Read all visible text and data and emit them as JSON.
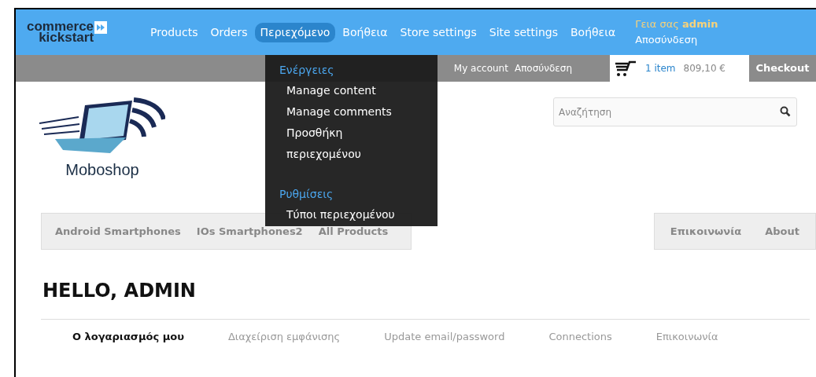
{
  "header": {
    "logo": {
      "line1": "commerce",
      "line2": "kickstart"
    },
    "nav": [
      {
        "label": "Products",
        "selected": false
      },
      {
        "label": "Orders",
        "selected": false
      },
      {
        "label": "Περιεχόμενο",
        "selected": true
      },
      {
        "label": "Βοήθεια",
        "selected": false
      },
      {
        "label": "Store settings",
        "selected": false
      },
      {
        "label": "Site settings",
        "selected": false
      },
      {
        "label": "Βοήθεια",
        "selected": false
      }
    ],
    "greeting": {
      "text": "Γεια σας",
      "user": "admin",
      "logout": "Αποσύνδεση"
    }
  },
  "dropdown": [
    {
      "heading": "Ενέργειες",
      "items": [
        "Manage content",
        "Manage comments",
        "Προσθήκη περιεχομένου"
      ]
    },
    {
      "heading": "Ρυθμίσεις",
      "items": [
        "Τύποι περιεχομένου"
      ]
    }
  ],
  "account_bar": {
    "links": [
      "My account",
      "Αποσύνδεση"
    ],
    "cart": {
      "count": "1 item",
      "total": "809,10 €"
    },
    "checkout": "Checkout"
  },
  "store": {
    "name": "Moboshop",
    "search": {
      "placeholder": "Αναζήτηση"
    }
  },
  "category_nav": [
    "Android Smartphones",
    "IOs Smartphones2",
    "All Products"
  ],
  "secondary_nav": [
    "Επικοινωνία",
    "About"
  ],
  "heading": "HELLO, ADMIN",
  "tabs": [
    {
      "label": "Ο λογαριασμός μου",
      "selected": true
    },
    {
      "label": "Διαχείριση εμφάνισης",
      "selected": false
    },
    {
      "label": "Update email/password",
      "selected": false
    },
    {
      "label": "Connections",
      "selected": false
    },
    {
      "label": "Επικοινωνία",
      "selected": false
    }
  ]
}
